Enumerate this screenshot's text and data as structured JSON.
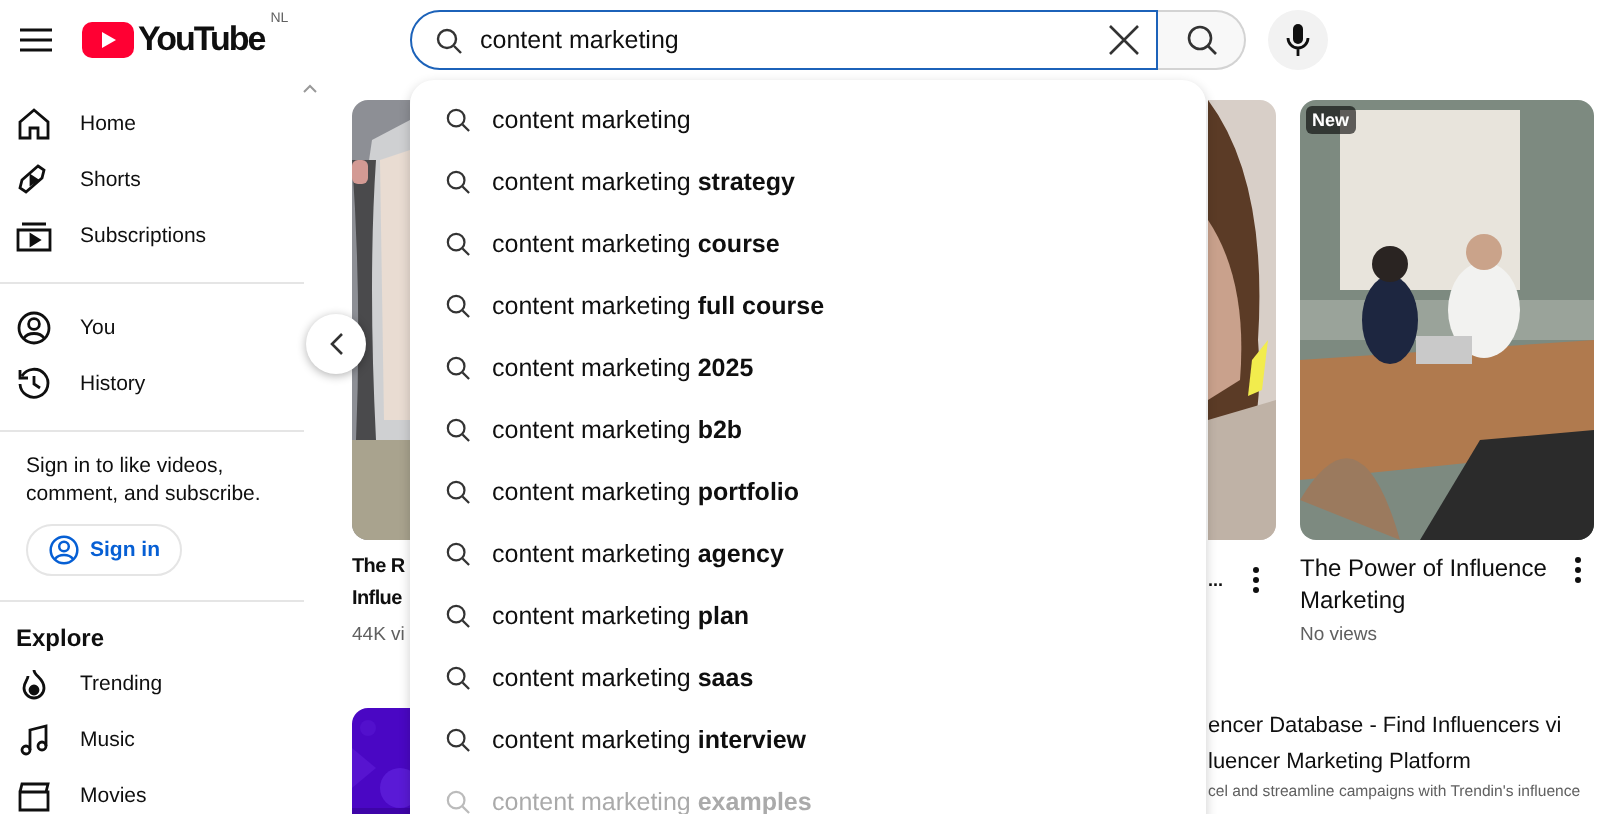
{
  "topbar": {
    "logo": "YouTube",
    "region": "NL",
    "search": {
      "value": "content marketing"
    }
  },
  "sidebar": {
    "groups": [
      {
        "items": [
          {
            "label": "Home"
          },
          {
            "label": "Shorts"
          },
          {
            "label": "Subscriptions"
          }
        ]
      },
      {
        "items": [
          {
            "label": "You"
          },
          {
            "label": "History"
          }
        ]
      }
    ],
    "signin": {
      "text": "Sign in to like videos, comment, and subscribe.",
      "button": "Sign in"
    },
    "explore": {
      "title": "Explore",
      "items": [
        {
          "label": "Trending"
        },
        {
          "label": "Music"
        },
        {
          "label": "Movies"
        }
      ]
    }
  },
  "suggestions": [
    {
      "text": "content marketing",
      "dimmed": false
    },
    {
      "text": "content marketing **strategy**",
      "dimmed": false
    },
    {
      "text": "content marketing **course**",
      "dimmed": false
    },
    {
      "text": "content marketing **full course**",
      "dimmed": false
    },
    {
      "text": "content marketing **2025**",
      "dimmed": false
    },
    {
      "text": "content marketing **b2b**",
      "dimmed": false
    },
    {
      "text": "content marketing **portfolio**",
      "dimmed": false
    },
    {
      "text": "content marketing **agency**",
      "dimmed": false
    },
    {
      "text": "content marketing **plan**",
      "dimmed": false
    },
    {
      "text": "content marketing **saas**",
      "dimmed": false
    },
    {
      "text": "content marketing **interview**",
      "dimmed": false
    },
    {
      "text": "content marketing **examples**",
      "dimmed": true
    }
  ],
  "cards": [
    {
      "kind": "left",
      "title_lines": [
        "The R",
        "Influe"
      ],
      "meta": "44K vi"
    },
    {
      "kind": "middle",
      "title_lines": [
        "..."
      ]
    },
    {
      "kind": "right",
      "badge": "New",
      "title": "The Power of Influence Marketing",
      "meta": "No views"
    }
  ],
  "ad": {
    "title_lines": [
      "encer Database - Find Influencers vi",
      "luencer Marketing Platform"
    ],
    "description": "cel and streamline campaigns with Trendin's influence"
  }
}
